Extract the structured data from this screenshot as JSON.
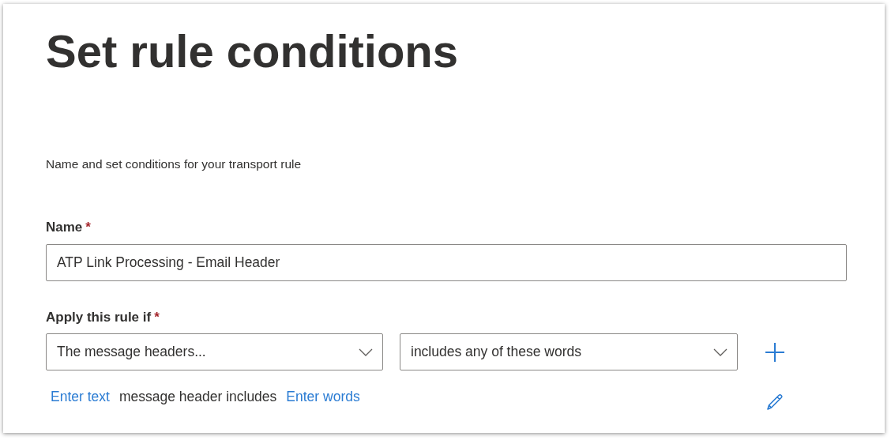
{
  "title": "Set rule conditions",
  "description": "Name and set conditions for your transport rule",
  "name_field": {
    "label": "Name",
    "required_mark": "*",
    "value": "ATP Link Processing - Email Header"
  },
  "condition": {
    "label": "Apply this rule if",
    "required_mark": "*",
    "dropdowns": [
      {
        "value": "The message headers..."
      },
      {
        "value": "includes any of these words"
      }
    ],
    "summary": [
      {
        "kind": "link",
        "text": "Enter text"
      },
      {
        "kind": "text",
        "text": "message header includes"
      },
      {
        "kind": "link",
        "text": "Enter words"
      }
    ]
  }
}
